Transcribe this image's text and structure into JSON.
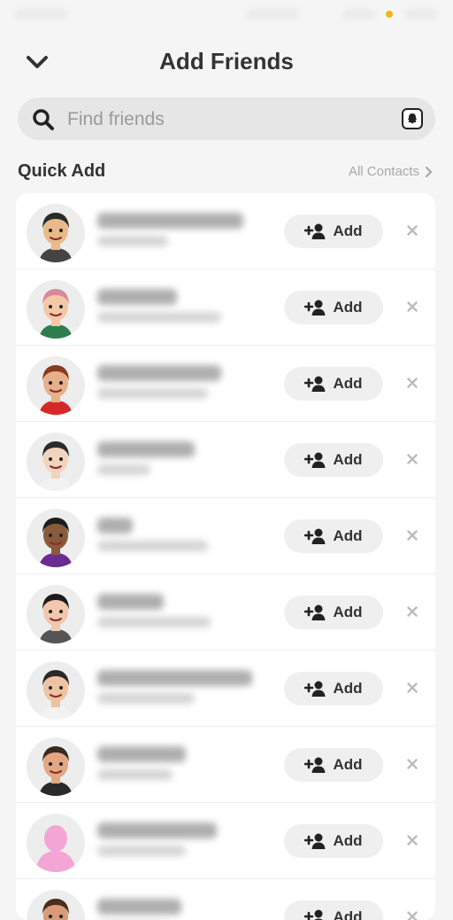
{
  "header": {
    "title": "Add Friends"
  },
  "search": {
    "placeholder": "Find friends"
  },
  "quick_add": {
    "title": "Quick Add",
    "all_contacts_label": "All Contacts",
    "add_label": "Add",
    "rows": [
      {
        "avatar": "bitmoji-avatar-beard"
      },
      {
        "avatar": "bitmoji-avatar-pink-hair"
      },
      {
        "avatar": "bitmoji-avatar-devil-horns"
      },
      {
        "avatar": "bitmoji-avatar-sunglasses-bun"
      },
      {
        "avatar": "bitmoji-avatar-rainbow"
      },
      {
        "avatar": "bitmoji-avatar-dark-hair"
      },
      {
        "avatar": "bitmoji-avatar-glasses-bun"
      },
      {
        "avatar": "bitmoji-avatar-headphones"
      },
      {
        "avatar": "default-avatar-silhouette"
      },
      {
        "avatar": "bitmoji-avatar-partial"
      }
    ]
  },
  "colors": {
    "background": "#f5f5f5",
    "card": "#ffffff",
    "button": "#efefef",
    "accent_dot": "#f4b31f",
    "silhouette": "#f3a6d6"
  }
}
